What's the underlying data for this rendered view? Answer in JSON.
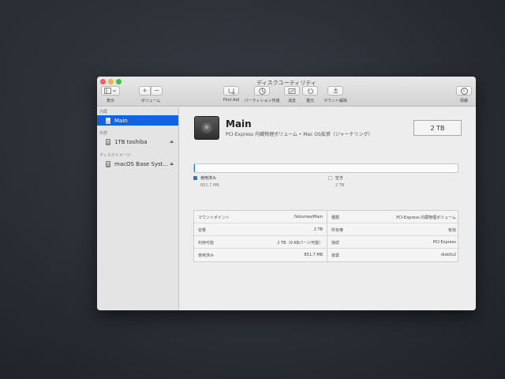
{
  "window": {
    "title": "ディスクユーティリティ"
  },
  "toolbar": {
    "view_label": "表示",
    "volume_label": "ボリューム",
    "firstaid_label": "First Aid",
    "partition_label": "パーティション作成",
    "erase_label": "消去",
    "restore_label": "復元",
    "mount_label": "マウント解除",
    "info_label": "情報",
    "add_glyph": "+",
    "remove_glyph": "−",
    "info_glyph": "i"
  },
  "sidebar": {
    "internal_header": "内蔵",
    "external_header": "外部",
    "images_header": "ディスクイメージ",
    "items": [
      {
        "label": "Main"
      },
      {
        "label": "1TB toshiba",
        "eject": "⏏"
      },
      {
        "label": "macOS Base Syst...",
        "eject": "⏏"
      }
    ]
  },
  "volume": {
    "name": "Main",
    "description": "PCI-Express 内蔵物理ボリューム • Mac OS拡張（ジャーナリング）",
    "size": "2 TB",
    "used_fraction": 0.0004
  },
  "legend": {
    "used_label": "使用済み",
    "used_value": "851.7 MB",
    "free_label": "空き",
    "free_value": "2 TB"
  },
  "info": {
    "left": [
      {
        "key": "マウントポイント",
        "value": "/Volumes/Main"
      },
      {
        "key": "容量",
        "value": "2 TB"
      },
      {
        "key": "利用可能",
        "value": "2 TB（0 KBパージ可能）"
      },
      {
        "key": "使用済み",
        "value": "851.7 MB"
      }
    ],
    "right": [
      {
        "key": "種類",
        "value": "PCI-Express 内蔵物理ボリューム"
      },
      {
        "key": "所有権",
        "value": "有効"
      },
      {
        "key": "接続",
        "value": "PCI-Express"
      },
      {
        "key": "装置",
        "value": "disk0s2"
      }
    ]
  },
  "colors": {
    "selection": "#1263e0",
    "used": "#1b79e6",
    "free": "#ffffff"
  }
}
